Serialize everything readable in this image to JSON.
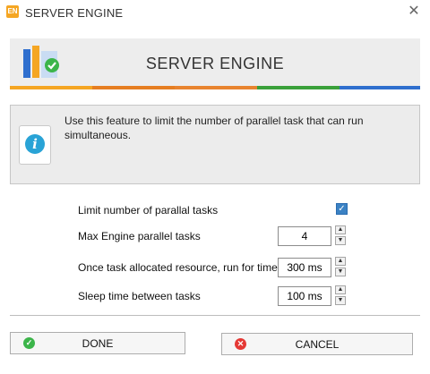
{
  "window": {
    "title": "SERVER ENGINE",
    "app_icon": "app-logo-icon",
    "close_icon": "close-icon"
  },
  "banner": {
    "title": "SERVER ENGINE",
    "stripe_colors": [
      "#f5a623",
      "#e67e22",
      "#e8842f",
      "#3aa13a",
      "#2f6fce"
    ]
  },
  "info": {
    "icon": "info-icon",
    "text": "Use this feature to limit the number of parallel task that can run simultaneous."
  },
  "settings": {
    "limit_label": "Limit number of parallal tasks",
    "limit_checked": true,
    "max_label": "Max Engine parallel tasks",
    "max_value": "4",
    "run_label": "Once task allocated resource, run for time",
    "run_value": "300 ms",
    "sleep_label": "Sleep time between tasks",
    "sleep_value": "100 ms"
  },
  "buttons": {
    "done_label": "DONE",
    "cancel_label": "CANCEL"
  },
  "colors": {
    "done_icon": "#3cb54a",
    "cancel_icon": "#e53935",
    "checkbox": "#3b82c4",
    "info_icon": "#29a3d6"
  }
}
